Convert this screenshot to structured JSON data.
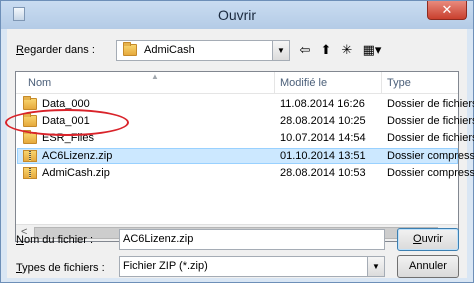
{
  "window": {
    "title": "Ouvrir",
    "close_glyph": "✕"
  },
  "lookin": {
    "label_pre": "R",
    "label_rest": "egarder dans :",
    "value": "AdmiCash"
  },
  "toolbar": [
    {
      "name": "back-icon",
      "glyph": "⇦"
    },
    {
      "name": "up-folder-icon",
      "glyph": "⬆"
    },
    {
      "name": "new-folder-icon",
      "glyph": "✳"
    },
    {
      "name": "view-menu-icon",
      "glyph": "▦▾"
    }
  ],
  "columns": {
    "name": "Nom",
    "modified": "Modifié le",
    "type": "Type"
  },
  "files": [
    {
      "name": "Data_000",
      "modified": "11.08.2014 16:26",
      "type": "Dossier de fichiers",
      "kind": "folder"
    },
    {
      "name": "Data_001",
      "modified": "28.08.2014 10:25",
      "type": "Dossier de fichiers",
      "kind": "folder"
    },
    {
      "name": "ESR_Files",
      "modified": "10.07.2014 14:54",
      "type": "Dossier de fichiers",
      "kind": "folder"
    },
    {
      "name": "AC6Lizenz.zip",
      "modified": "01.10.2014 13:51",
      "type": "Dossier compressé",
      "kind": "zip",
      "selected": true
    },
    {
      "name": "AdmiCash.zip",
      "modified": "28.08.2014 10:53",
      "type": "Dossier compressé",
      "kind": "zip"
    }
  ],
  "scroll": {
    "left": "<",
    "right": ">"
  },
  "filename": {
    "label_pre": "N",
    "label_rest": "om du fichier :",
    "value": "AC6Lizenz.zip"
  },
  "filetype": {
    "label_pre": "T",
    "label_rest": "ypes de fichiers :",
    "value": "Fichier ZIP (*.zip)"
  },
  "buttons": {
    "open_pre": "O",
    "open_rest": "uvrir",
    "cancel": "Annuler"
  },
  "colors": {
    "selection": "#cce8ff",
    "highlight_ring": "#d9232a",
    "close_button": "#c9402e"
  }
}
